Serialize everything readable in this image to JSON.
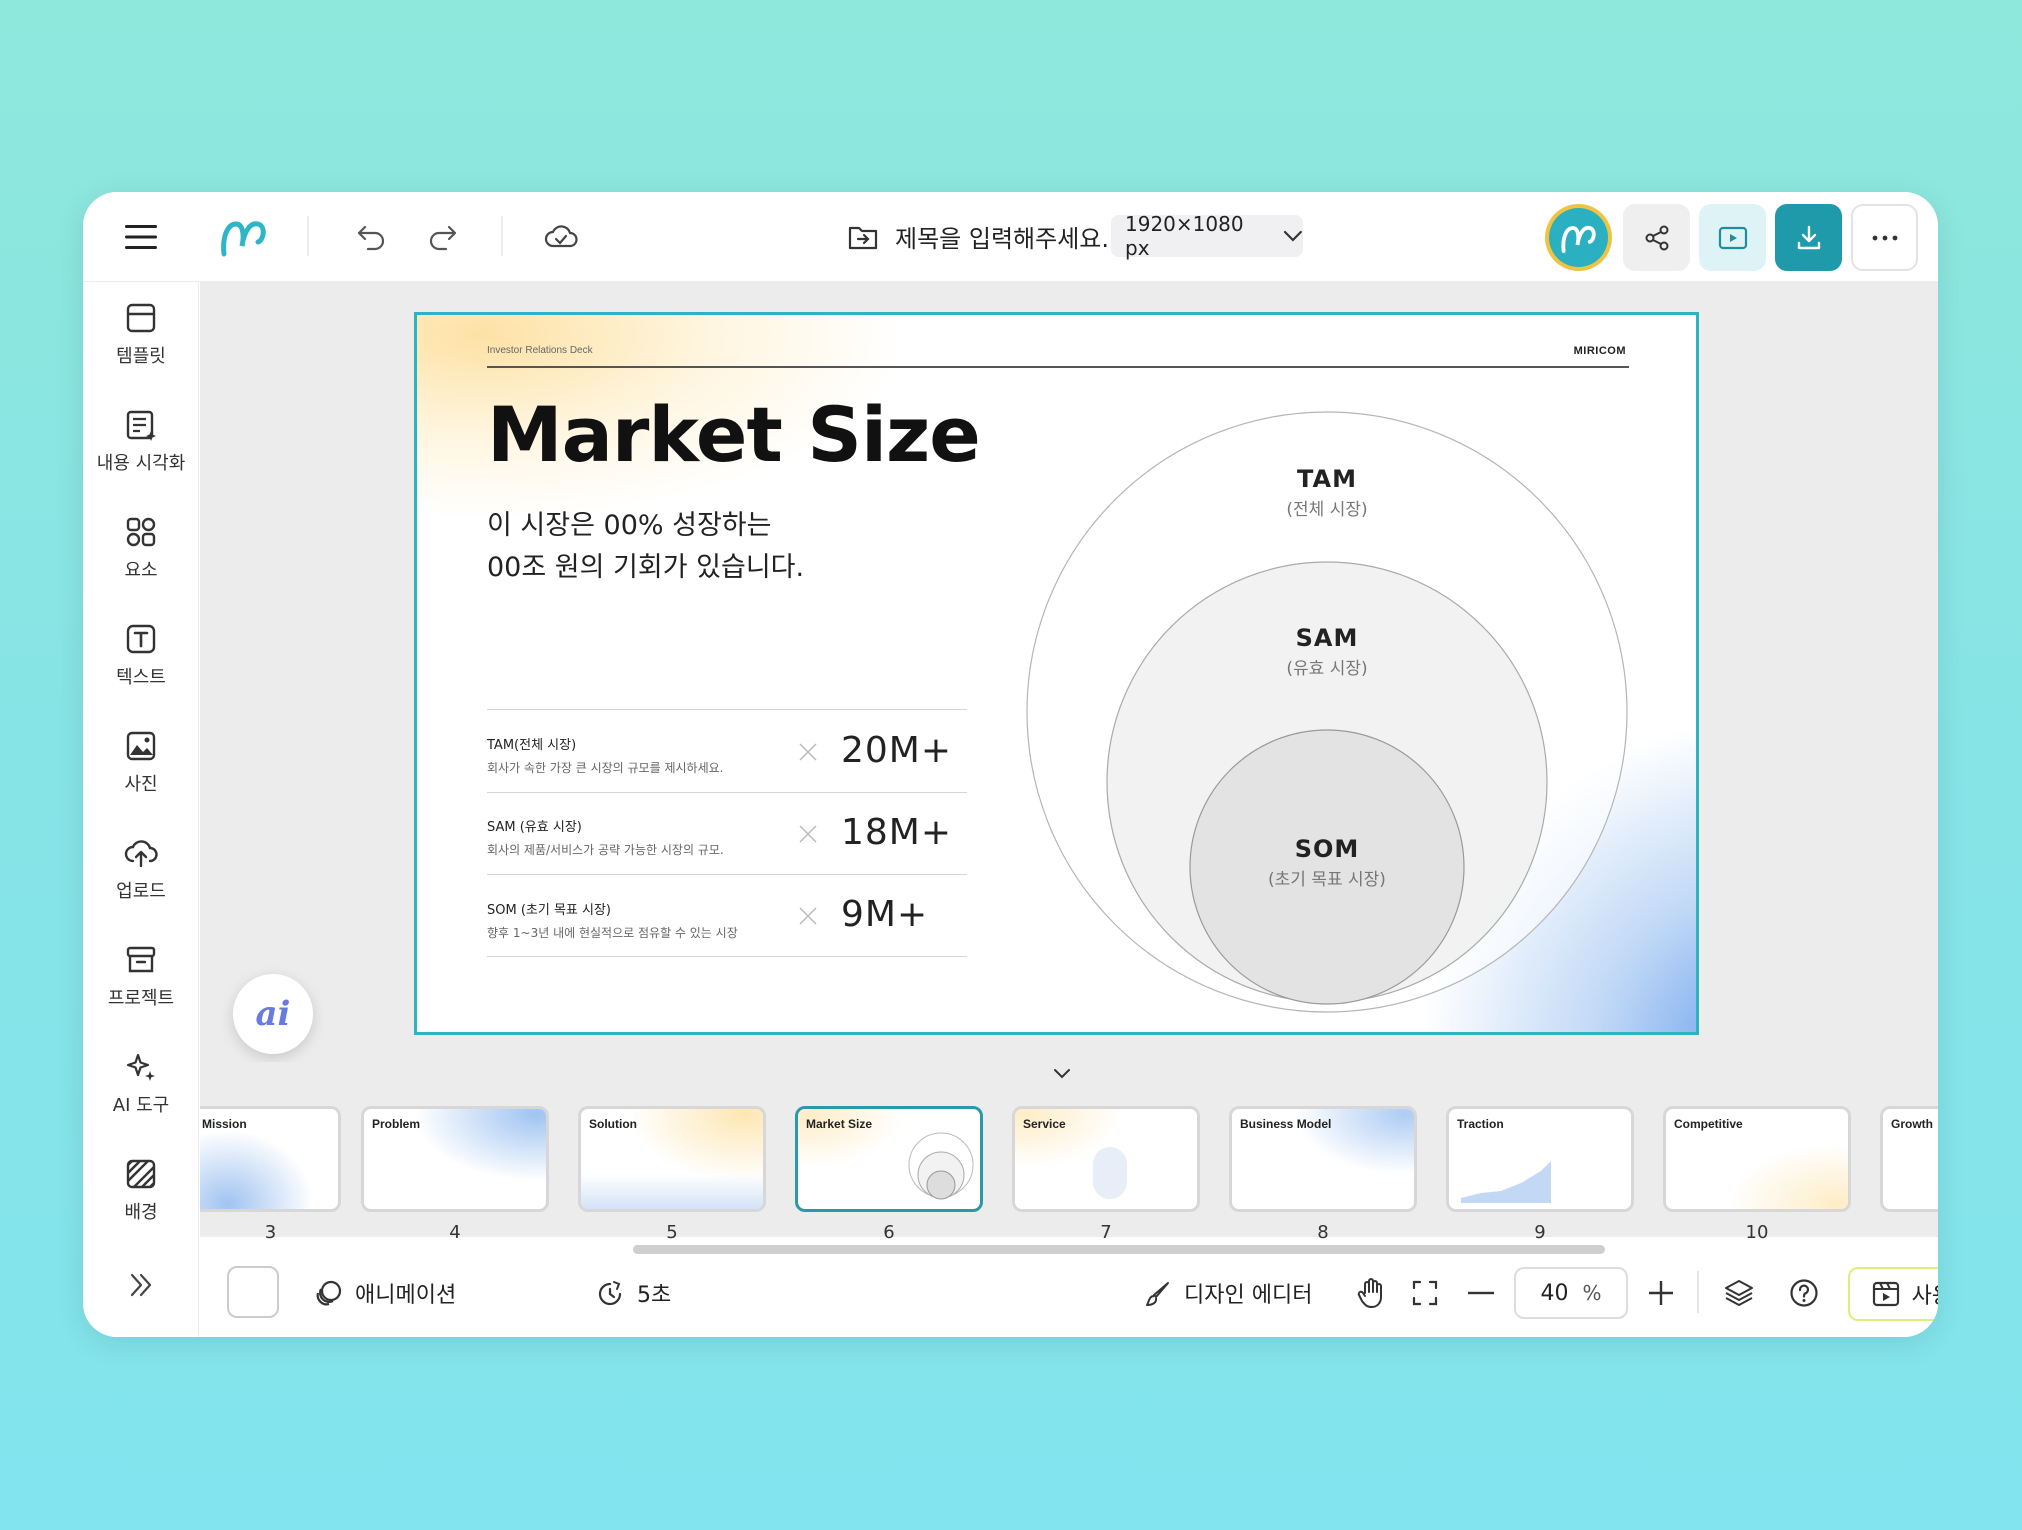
{
  "app": {
    "doc_title": "제목을 입력해주세요.",
    "canvas_size": "1920×1080 px",
    "accent": "#2a9aa7"
  },
  "sidebar": {
    "items": [
      {
        "label": "템플릿",
        "icon": "template-icon"
      },
      {
        "label": "내용 시각화",
        "icon": "content-visualize-icon"
      },
      {
        "label": "요소",
        "icon": "elements-icon"
      },
      {
        "label": "텍스트",
        "icon": "text-icon"
      },
      {
        "label": "사진",
        "icon": "photo-icon"
      },
      {
        "label": "업로드",
        "icon": "upload-icon"
      },
      {
        "label": "프로젝트",
        "icon": "project-icon"
      },
      {
        "label": "AI 도구",
        "icon": "ai-tools-icon"
      },
      {
        "label": "배경",
        "icon": "background-icon"
      }
    ]
  },
  "slide": {
    "header_left": "Investor Relations Deck",
    "header_right": "MIRICOM",
    "title": "Market Size",
    "subtitle_line1": "이 시장은 00% 성장하는",
    "subtitle_line2": "00조 원의 기회가 있습니다.",
    "rows": [
      {
        "label": "TAM(전체 시장)",
        "desc": "회사가 속한 가장 큰 시장의 규모를 제시하세요.",
        "value": "20M+"
      },
      {
        "label": "SAM (유효 시장)",
        "desc": "회사의 제품/서비스가 공략 가능한 시장의 규모.",
        "value": "18M+"
      },
      {
        "label": "SOM (초기 목표 시장)",
        "desc": "향후 1~3년 내에 현실적으로 점유할 수 있는 시장",
        "value": "9M+"
      }
    ],
    "circles": [
      {
        "name": "TAM",
        "sub": "(전체 시장)"
      },
      {
        "name": "SAM",
        "sub": "(유효 시장)"
      },
      {
        "name": "SOM",
        "sub": "(초기 목표 시장)"
      }
    ],
    "ai_button": "ai"
  },
  "filmstrip": {
    "thumbs": [
      {
        "title": "Mission",
        "num": "3"
      },
      {
        "title": "Problem",
        "num": "4"
      },
      {
        "title": "Solution",
        "num": "5"
      },
      {
        "title": "Market Size",
        "num": "6"
      },
      {
        "title": "Service",
        "num": "7"
      },
      {
        "title": "Business Model",
        "num": "8"
      },
      {
        "title": "Traction",
        "num": "9"
      },
      {
        "title": "Competitive",
        "num": "10"
      },
      {
        "title": "Growth",
        "num": ""
      }
    ]
  },
  "bottombar": {
    "animation_label": "애니메이션",
    "duration_label": "5초",
    "design_editor_label": "디자인 에디터",
    "zoom_value": "40",
    "zoom_unit": "%",
    "help_label": "사용법"
  }
}
